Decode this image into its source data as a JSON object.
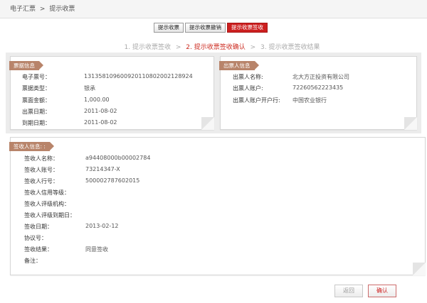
{
  "breadcrumb": {
    "root": "电子汇票",
    "separator": ">",
    "current": "提示收票"
  },
  "tabs": [
    {
      "label": "提示收票"
    },
    {
      "label": "提示收票撤销"
    },
    {
      "label": "提示收票签收"
    }
  ],
  "steps": {
    "step1": "1. 提示收票签收",
    "step2": "2. 提示收票签收确认",
    "step3": "3. 提示收票签收结果",
    "separator": ">"
  },
  "bill_info": {
    "title": "票据信息",
    "rows": [
      {
        "label": "电子票号：",
        "value": "131358109600920110802002128924"
      },
      {
        "label": "票据类型：",
        "value": "银承"
      },
      {
        "label": "票面金额：",
        "value": "1,000.00"
      },
      {
        "label": "出票日期：",
        "value": "2011-08-02"
      },
      {
        "label": "到期日期：",
        "value": "2011-08-02"
      }
    ]
  },
  "drawer_info": {
    "title": "出票人信息",
    "rows": [
      {
        "label": "出票人名称:",
        "value": "北大方正投资有限公司"
      },
      {
        "label": "出票人账户:",
        "value": "72260562223435"
      },
      {
        "label": "出票人账户开户行:",
        "value": "中国农业银行"
      }
    ]
  },
  "signer_info": {
    "title": "签收人信息: :",
    "rows": [
      {
        "label": "签收人名称：",
        "value": "a94408000b00002784"
      },
      {
        "label": "签收人账号：",
        "value": "73214347-X"
      },
      {
        "label": "签收人行号：",
        "value": "500002787602015"
      },
      {
        "label": "签收人信用等级：",
        "value": ""
      },
      {
        "label": "签收人评级机构：",
        "value": ""
      },
      {
        "label": "签收人评级到期日：",
        "value": ""
      },
      {
        "label": "签收日期：",
        "value": "2013-02-12"
      },
      {
        "label": "协议号：",
        "value": ""
      },
      {
        "label": "签收结果：",
        "value": "同意签收"
      },
      {
        "label": "备注：",
        "value": ""
      }
    ]
  },
  "buttons": {
    "back": "返回",
    "confirm": "确认"
  }
}
